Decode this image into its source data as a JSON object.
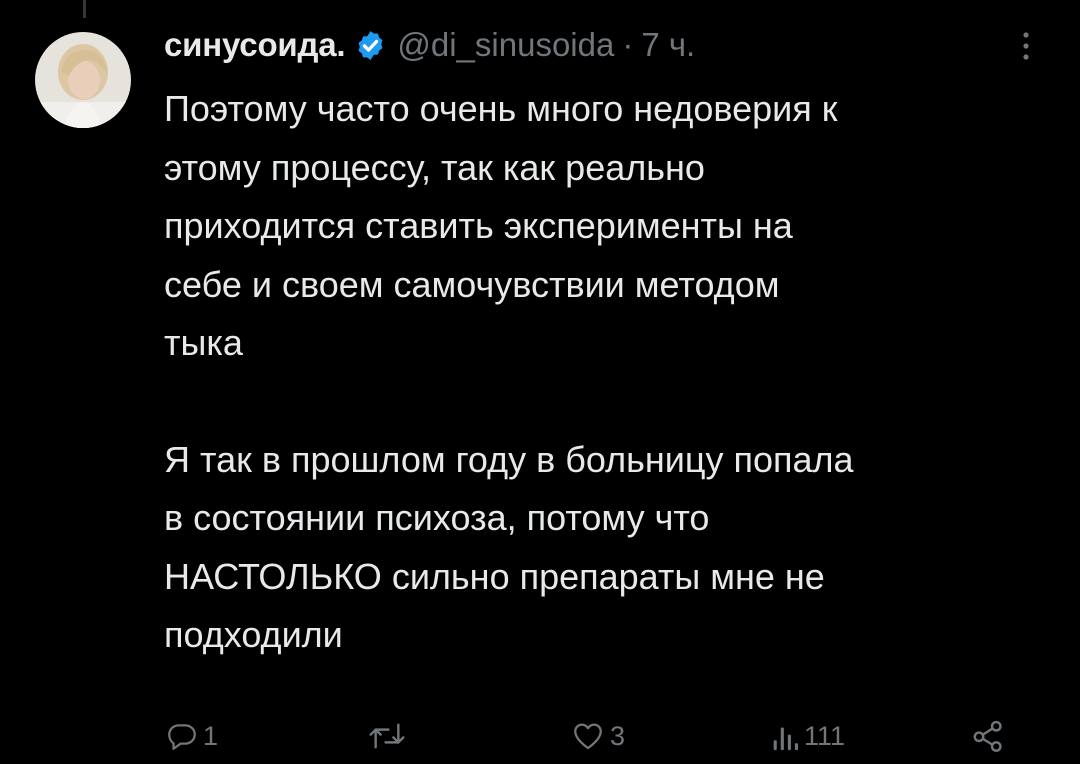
{
  "tweet": {
    "author": {
      "display_name": "синусоида.",
      "handle": "@di_sinusoida",
      "verified": true
    },
    "separator": "·",
    "timestamp": "7 ч.",
    "paragraphs": [
      "Поэтому часто очень много недоверия к\nэтому процессу, так как реально\nприходится ставить эксперименты на\nсебе и своем самочувствии методом\nтыка",
      "Я так в прошлом году в больницу попала\nв состоянии психоза, потому что\nНАСТОЛЬКО сильно препараты мне не\nподходили"
    ]
  },
  "actions": {
    "reply_count": "1",
    "retweet_count": "",
    "like_count": "3",
    "views_count": "111"
  },
  "icons": {
    "more": "more-vertical-icon",
    "verified": "verified-badge-icon",
    "reply": "reply-icon",
    "retweet": "retweet-icon",
    "like": "heart-icon",
    "views": "views-icon",
    "share": "share-icon"
  },
  "colors": {
    "background": "#000000",
    "text_primary": "#e7e9ea",
    "text_secondary": "#71767b",
    "verified_blue": "#1d9bf0"
  }
}
